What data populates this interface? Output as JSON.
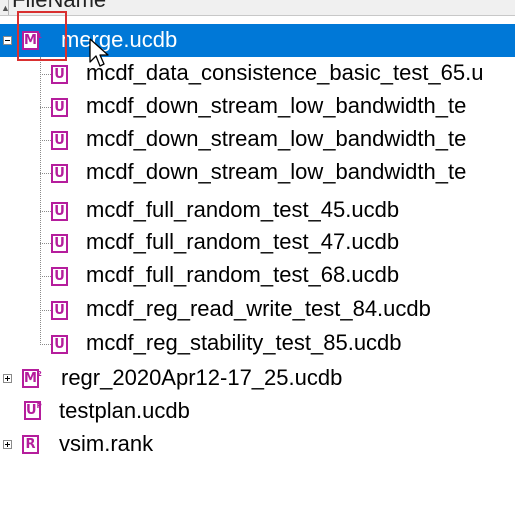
{
  "header": {
    "column_label": "FileName"
  },
  "tree": {
    "merge": {
      "label": "merge.ucdb",
      "expanded": true,
      "icon": "merge-ucdb-icon"
    },
    "children": [
      {
        "label": "mcdf_data_consistence_basic_test_65.u"
      },
      {
        "label": "mcdf_down_stream_low_bandwidth_te"
      },
      {
        "label": "mcdf_down_stream_low_bandwidth_te"
      },
      {
        "label": "mcdf_down_stream_low_bandwidth_te"
      },
      {
        "label": "mcdf_full_random_test_45.ucdb"
      },
      {
        "label": "mcdf_full_random_test_47.ucdb"
      },
      {
        "label": "mcdf_full_random_test_68.ucdb"
      },
      {
        "label": "mcdf_reg_read_write_test_84.ucdb"
      },
      {
        "label": "mcdf_reg_stability_test_85.ucdb"
      }
    ],
    "regr": {
      "label": "regr_2020Apr12-17_25.ucdb",
      "expanded": false
    },
    "testplan": {
      "label": "testplan.ucdb"
    },
    "vsim": {
      "label": "vsim.rank",
      "expanded": false
    }
  },
  "colors": {
    "selection": "#0078d7",
    "icon": "#b51d9c",
    "highlight_box": "#d93030"
  }
}
